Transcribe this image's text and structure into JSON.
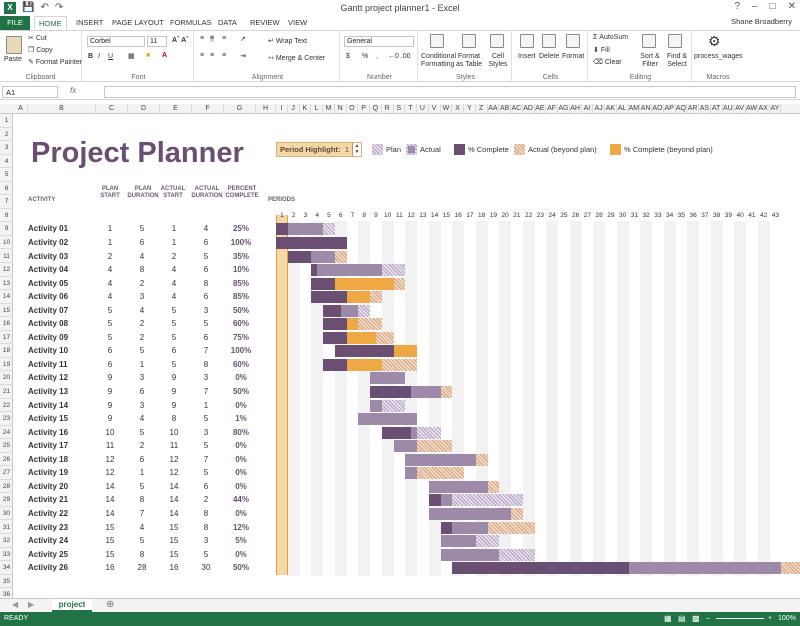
{
  "window": {
    "title": "Gantt project planner1 - Excel",
    "user": "Shane Broadberry"
  },
  "tabs": [
    "FILE",
    "HOME",
    "INSERT",
    "PAGE LAYOUT",
    "FORMULAS",
    "DATA",
    "REVIEW",
    "VIEW"
  ],
  "ribbon": {
    "clipboard": {
      "paste": "Paste",
      "cut": "Cut",
      "copy": "Copy",
      "format_painter": "Format Painter",
      "label": "Clipboard"
    },
    "font": {
      "name": "Corbel",
      "size": "11",
      "label": "Font"
    },
    "alignment": {
      "wrap": "Wrap Text",
      "merge": "Merge & Center",
      "label": "Alignment"
    },
    "number": {
      "format": "General",
      "label": "Number"
    },
    "styles": {
      "cond": "Conditional Formatting",
      "table": "Format as Table",
      "cell": "Cell Styles",
      "label": "Styles"
    },
    "cells": {
      "insert": "Insert",
      "delete": "Delete",
      "format": "Format",
      "label": "Cells"
    },
    "editing": {
      "autosum": "AutoSum",
      "fill": "Fill",
      "clear": "Clear",
      "sort": "Sort & Filter",
      "find": "Find & Select",
      "label": "Editing"
    },
    "macros": {
      "name": "process_wages",
      "label": "Macros"
    }
  },
  "namebox": "A1",
  "fx": "fx",
  "columns": [
    "A",
    "B",
    "C",
    "D",
    "E",
    "F",
    "G",
    "H",
    "I",
    "J",
    "K",
    "L",
    "M",
    "N",
    "O",
    "P",
    "Q",
    "R",
    "S",
    "T",
    "U",
    "V",
    "W",
    "X",
    "Y",
    "Z",
    "AA",
    "AB",
    "AC",
    "AD",
    "AE",
    "AF",
    "AG",
    "AH",
    "AI",
    "AJ",
    "AK",
    "AL",
    "AM",
    "AN",
    "AO",
    "AP",
    "AQ",
    "AR",
    "AS",
    "AT",
    "AU",
    "AV",
    "AW",
    "AX",
    "AY"
  ],
  "rows": [
    "1",
    "2",
    "3",
    "4",
    "5",
    "6",
    "7",
    "8",
    "9",
    "10",
    "11",
    "12",
    "13",
    "14",
    "15",
    "16",
    "17",
    "18",
    "19",
    "20",
    "21",
    "22",
    "23",
    "24",
    "25",
    "26",
    "27",
    "28",
    "29",
    "30",
    "31",
    "32",
    "33",
    "34",
    "35",
    "36",
    "37"
  ],
  "planner": {
    "title": "Project Planner",
    "period_highlight_label": "Period Highlight:",
    "period_highlight_value": "1",
    "legend": {
      "plan": "Plan",
      "actual": "Actual",
      "complete": "% Complete",
      "beyond": "Actual (beyond plan)",
      "cbeyond": "% Complete (beyond plan)"
    },
    "headers": {
      "activity": "ACTIVITY",
      "plan_start": "PLAN START",
      "plan_duration": "PLAN DURATION",
      "actual_start": "ACTUAL START",
      "actual_duration": "ACTUAL DURATION",
      "percent": "PERCENT COMPLETE",
      "periods": "PERIODS"
    },
    "periods": [
      "1",
      "2",
      "3",
      "4",
      "5",
      "6",
      "7",
      "8",
      "9",
      "10",
      "11",
      "12",
      "13",
      "14",
      "15",
      "16",
      "17",
      "18",
      "19",
      "20",
      "21",
      "22",
      "23",
      "24",
      "25",
      "26",
      "27",
      "28",
      "29",
      "30",
      "31",
      "32",
      "33",
      "34",
      "35",
      "36",
      "37",
      "38",
      "39",
      "40",
      "41",
      "42",
      "43"
    ],
    "activities": [
      {
        "name": "Activity 01",
        "ps": "1",
        "pd": "5",
        "as": "1",
        "ad": "4",
        "pct": "25%"
      },
      {
        "name": "Activity 02",
        "ps": "1",
        "pd": "6",
        "as": "1",
        "ad": "6",
        "pct": "100%"
      },
      {
        "name": "Activity 03",
        "ps": "2",
        "pd": "4",
        "as": "2",
        "ad": "5",
        "pct": "35%"
      },
      {
        "name": "Activity 04",
        "ps": "4",
        "pd": "8",
        "as": "4",
        "ad": "6",
        "pct": "10%"
      },
      {
        "name": "Activity 05",
        "ps": "4",
        "pd": "2",
        "as": "4",
        "ad": "8",
        "pct": "85%"
      },
      {
        "name": "Activity 06",
        "ps": "4",
        "pd": "3",
        "as": "4",
        "ad": "6",
        "pct": "85%"
      },
      {
        "name": "Activity 07",
        "ps": "5",
        "pd": "4",
        "as": "5",
        "ad": "3",
        "pct": "50%"
      },
      {
        "name": "Activity 08",
        "ps": "5",
        "pd": "2",
        "as": "5",
        "ad": "5",
        "pct": "60%"
      },
      {
        "name": "Activity 09",
        "ps": "5",
        "pd": "2",
        "as": "5",
        "ad": "6",
        "pct": "75%"
      },
      {
        "name": "Activity 10",
        "ps": "6",
        "pd": "5",
        "as": "6",
        "ad": "7",
        "pct": "100%"
      },
      {
        "name": "Activity 11",
        "ps": "6",
        "pd": "1",
        "as": "5",
        "ad": "8",
        "pct": "60%"
      },
      {
        "name": "Activity 12",
        "ps": "9",
        "pd": "3",
        "as": "9",
        "ad": "3",
        "pct": "0%"
      },
      {
        "name": "Activity 13",
        "ps": "9",
        "pd": "6",
        "as": "9",
        "ad": "7",
        "pct": "50%"
      },
      {
        "name": "Activity 14",
        "ps": "9",
        "pd": "3",
        "as": "9",
        "ad": "1",
        "pct": "0%"
      },
      {
        "name": "Activity 15",
        "ps": "9",
        "pd": "4",
        "as": "8",
        "ad": "5",
        "pct": "1%"
      },
      {
        "name": "Activity 16",
        "ps": "10",
        "pd": "5",
        "as": "10",
        "ad": "3",
        "pct": "80%"
      },
      {
        "name": "Activity 17",
        "ps": "11",
        "pd": "2",
        "as": "11",
        "ad": "5",
        "pct": "0%"
      },
      {
        "name": "Activity 18",
        "ps": "12",
        "pd": "6",
        "as": "12",
        "ad": "7",
        "pct": "0%"
      },
      {
        "name": "Activity 19",
        "ps": "12",
        "pd": "1",
        "as": "12",
        "ad": "5",
        "pct": "0%"
      },
      {
        "name": "Activity 20",
        "ps": "14",
        "pd": "5",
        "as": "14",
        "ad": "6",
        "pct": "0%"
      },
      {
        "name": "Activity 21",
        "ps": "14",
        "pd": "8",
        "as": "14",
        "ad": "2",
        "pct": "44%"
      },
      {
        "name": "Activity 22",
        "ps": "14",
        "pd": "7",
        "as": "14",
        "ad": "8",
        "pct": "0%"
      },
      {
        "name": "Activity 23",
        "ps": "15",
        "pd": "4",
        "as": "15",
        "ad": "8",
        "pct": "12%"
      },
      {
        "name": "Activity 24",
        "ps": "15",
        "pd": "5",
        "as": "15",
        "ad": "3",
        "pct": "5%"
      },
      {
        "name": "Activity 25",
        "ps": "15",
        "pd": "8",
        "as": "15",
        "ad": "5",
        "pct": "0%"
      },
      {
        "name": "Activity 26",
        "ps": "16",
        "pd": "28",
        "as": "16",
        "ad": "30",
        "pct": "50%"
      }
    ]
  },
  "sheet_tab": "project",
  "status": {
    "ready": "READY",
    "zoom": "100%"
  },
  "colors": {
    "accent": "#217346",
    "title": "#6b4f73",
    "highlight": "#f6d7a6",
    "complete": "#6b4f73",
    "plan": "#b9a8c6",
    "beyond": "#d9a882",
    "cbeyond": "#f0a844"
  }
}
